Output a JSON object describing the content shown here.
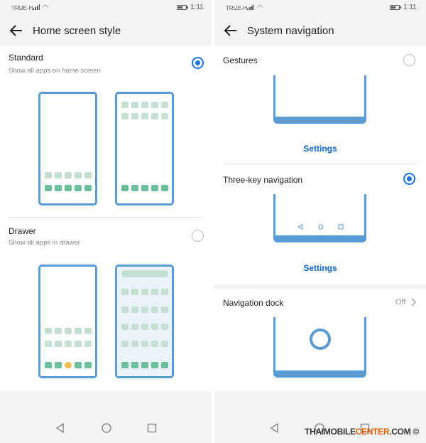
{
  "status_left": {
    "carrier": "TRUE-H",
    "time": "1:11"
  },
  "status_right": {
    "carrier": "TRUE-H",
    "time": "1:11"
  },
  "left": {
    "title": "Home screen style",
    "standard": {
      "title": "Standard",
      "subtitle": "Show all apps on home screen",
      "selected": true
    },
    "drawer": {
      "title": "Drawer",
      "subtitle": "Show all apps in drawer",
      "selected": false
    }
  },
  "right": {
    "title": "System navigation",
    "gestures": {
      "title": "Gestures",
      "settings": "Settings",
      "selected": false
    },
    "three_key": {
      "title": "Three-key navigation",
      "settings": "Settings",
      "selected": true
    },
    "dock": {
      "title": "Navigation dock",
      "value": "Off"
    }
  },
  "watermark": {
    "part1": "THAIMOBILE",
    "part2": "CENTER",
    "part3": ".COM"
  },
  "colors": {
    "accent": "#1a73e8",
    "illustration_blue": "#5a9bd4",
    "app_green": "#6cbf9b"
  }
}
